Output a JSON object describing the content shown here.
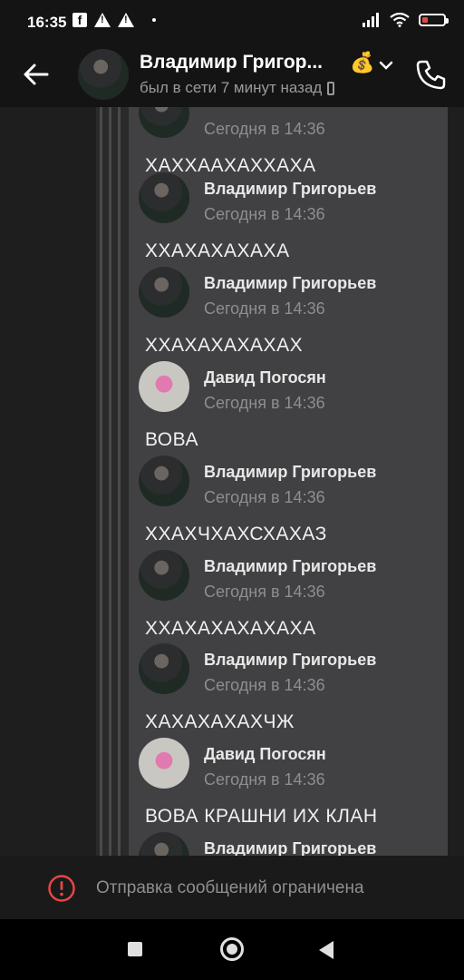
{
  "status_bar": {
    "time": "16:35"
  },
  "header": {
    "contact_name": "Владимир Григор...",
    "emoji": "💰",
    "status": "был в сети 7 минут назад"
  },
  "messages": [
    {
      "author": "",
      "time": "Сегодня в 14:36",
      "text": "ХАХХААХАХХАХА",
      "avatar": "vladimir"
    },
    {
      "author": "Владимир Григорьев",
      "time": "Сегодня в 14:36",
      "text": "ХХАХАХАХАХА",
      "avatar": "vladimir"
    },
    {
      "author": "Владимир Григорьев",
      "time": "Сегодня в 14:36",
      "text": "ХХАХАХАХАХАХ",
      "avatar": "vladimir"
    },
    {
      "author": "Давид Погосян",
      "time": "Сегодня в 14:36",
      "text": "ВОВА",
      "avatar": "david"
    },
    {
      "author": "Владимир Григорьев",
      "time": "Сегодня в 14:36",
      "text": "ХХАХЧХАХСХАХАЗ",
      "avatar": "vladimir"
    },
    {
      "author": "Владимир Григорьев",
      "time": "Сегодня в 14:36",
      "text": "ХХАХАХАХАХАХА",
      "avatar": "vladimir"
    },
    {
      "author": "Владимир Григорьев",
      "time": "Сегодня в 14:36",
      "text": "ХАХАХАХАХЧЖ",
      "avatar": "vladimir"
    },
    {
      "author": "Давид Погосян",
      "time": "Сегодня в 14:36",
      "text": "ВОВА КРАШНИ ИХ КЛАН",
      "avatar": "david"
    },
    {
      "author": "Владимир Григорьев",
      "time": "",
      "text": "",
      "avatar": "vladimir"
    }
  ],
  "restriction": {
    "text": "Отправка сообщений ограничена"
  }
}
